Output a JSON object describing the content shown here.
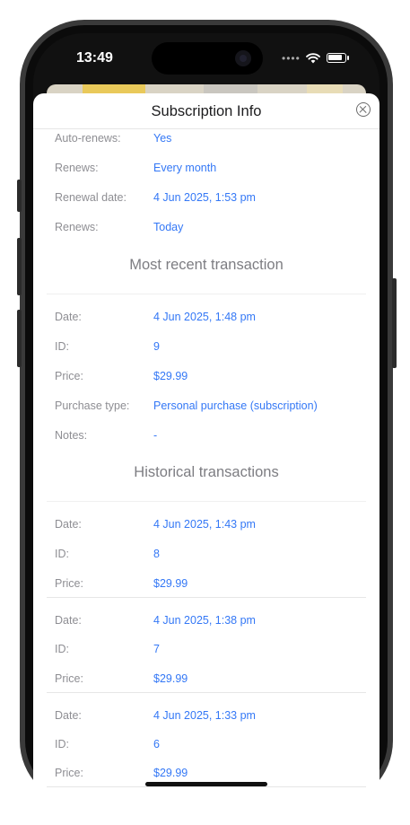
{
  "status_bar": {
    "time": "13:49"
  },
  "sheet": {
    "title": "Subscription Info"
  },
  "subscription": [
    {
      "label": "Auto-renews:",
      "value": "Yes"
    },
    {
      "label": "Renews:",
      "value": "Every month"
    },
    {
      "label": "Renewal date:",
      "value": "4 Jun 2025, 1:53 pm"
    },
    {
      "label": "Renews:",
      "value": "Today"
    }
  ],
  "recent": {
    "title": "Most recent transaction",
    "rows": [
      {
        "label": "Date:",
        "value": "4 Jun 2025, 1:48 pm"
      },
      {
        "label": "ID:",
        "value": "9"
      },
      {
        "label": "Price:",
        "value": "$29.99"
      },
      {
        "label": "Purchase type:",
        "value": "Personal purchase (subscription)"
      },
      {
        "label": "Notes:",
        "value": "-"
      }
    ]
  },
  "historical": {
    "title": "Historical transactions",
    "transactions": [
      {
        "rows": [
          {
            "label": "Date:",
            "value": "4 Jun 2025, 1:43 pm"
          },
          {
            "label": "ID:",
            "value": "8"
          },
          {
            "label": "Price:",
            "value": "$29.99"
          }
        ]
      },
      {
        "rows": [
          {
            "label": "Date:",
            "value": "4 Jun 2025, 1:38 pm"
          },
          {
            "label": "ID:",
            "value": "7"
          },
          {
            "label": "Price:",
            "value": "$29.99"
          }
        ]
      },
      {
        "rows": [
          {
            "label": "Date:",
            "value": "4 Jun 2025, 1:33 pm"
          },
          {
            "label": "ID:",
            "value": "6"
          },
          {
            "label": "Price:",
            "value": "$29.99"
          }
        ]
      }
    ]
  }
}
